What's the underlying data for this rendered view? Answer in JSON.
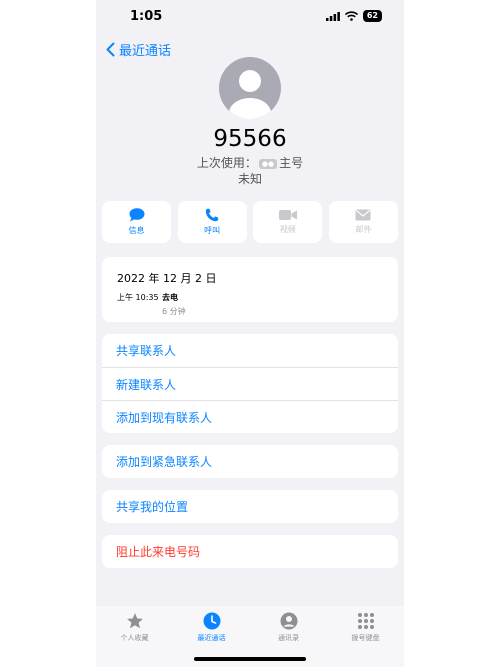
{
  "status": {
    "time": "1:05",
    "battery": "62"
  },
  "nav": {
    "back_label": "最近通话"
  },
  "contact": {
    "number": "95566",
    "last_used_prefix": "上次使用：",
    "last_used_suffix": "主号",
    "location": "未知"
  },
  "actions": [
    {
      "label": "信息",
      "icon": "message-icon",
      "enabled": true
    },
    {
      "label": "呼叫",
      "icon": "phone-icon",
      "enabled": true
    },
    {
      "label": "视频",
      "icon": "video-icon",
      "enabled": false
    },
    {
      "label": "邮件",
      "icon": "mail-icon",
      "enabled": false
    }
  ],
  "call_history": {
    "date": "2022 年 12 月 2 日",
    "time": "上午 10:35",
    "type": "去电",
    "duration": "6 分钟"
  },
  "menu": {
    "share_contact": "共享联系人",
    "new_contact": "新建联系人",
    "add_existing": "添加到现有联系人",
    "add_emergency": "添加到紧急联系人",
    "share_location": "共享我的位置",
    "block_caller": "阻止此来电号码"
  },
  "tabs": [
    {
      "label": "个人收藏",
      "icon": "star-icon",
      "active": false
    },
    {
      "label": "最近通话",
      "icon": "clock-icon",
      "active": true
    },
    {
      "label": "通讯录",
      "icon": "contacts-icon",
      "active": false
    },
    {
      "label": "拨号键盘",
      "icon": "keypad-icon",
      "active": false
    }
  ],
  "colors": {
    "accent": "#0a84ff",
    "destructive": "#ff3b30",
    "background": "#f1f1f6"
  }
}
